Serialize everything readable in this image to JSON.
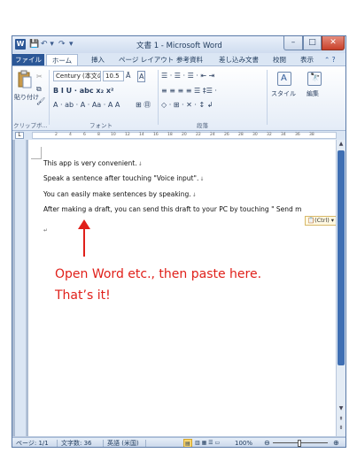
{
  "window": {
    "title": "文書 1 - Microsoft Word",
    "app_icon": "W",
    "quick_access": [
      "💾",
      "↶ ▾",
      "↷",
      "▾"
    ]
  },
  "tabs": [
    "ファイル",
    "ホーム",
    "挿入",
    "ページ レイアウト",
    "参考資料",
    "差し込み文書",
    "校閲",
    "表示"
  ],
  "ribbon": {
    "clipboard": {
      "paste_label": "貼り付け",
      "group_label": "クリップボ..."
    },
    "font": {
      "font_name": "Century (本文のフォント",
      "font_size": "10.5",
      "group_label": "フォント",
      "row2": "B  I  U · abc  x₂  x²",
      "row3": "A · ab · A · Aa ·  A  A"
    },
    "paragraph": {
      "group_label": "段落",
      "row1": "☰ · ☰ · ☰ ·  ⇤ ⇥",
      "row2": "≡  ≡  ≡  ≡  ☰  ‡☰ ·",
      "row3": "◇ · ⊞ ·  ✕ ·  ↕  ↲"
    },
    "styles": {
      "label": "スタイル"
    },
    "editing": {
      "label": "編集"
    }
  },
  "ruler": {
    "numbers": [
      "2",
      "4",
      "6",
      "8",
      "10",
      "12",
      "14",
      "16",
      "18",
      "20",
      "22",
      "24",
      "26",
      "28",
      "30",
      "32",
      "34",
      "36",
      "38"
    ]
  },
  "document": {
    "lines": [
      "This app is very convenient.",
      "Speak a sentence after touching \"Voice input\".",
      "You can easily make sentences by speaking.",
      "After making a draft, you can send this draft to your PC by touching \" Send m"
    ],
    "paste_options": "(Ctrl) ▾"
  },
  "annotation": {
    "line1": "Open Word etc., then paste here.",
    "line2": "That’s  it!",
    "color": "#e0201a"
  },
  "status": {
    "page": "ページ: 1/1",
    "word_count": "文字数: 36",
    "language": "英語 (米国)",
    "zoom": "100%",
    "zoom_level": 1.0
  }
}
